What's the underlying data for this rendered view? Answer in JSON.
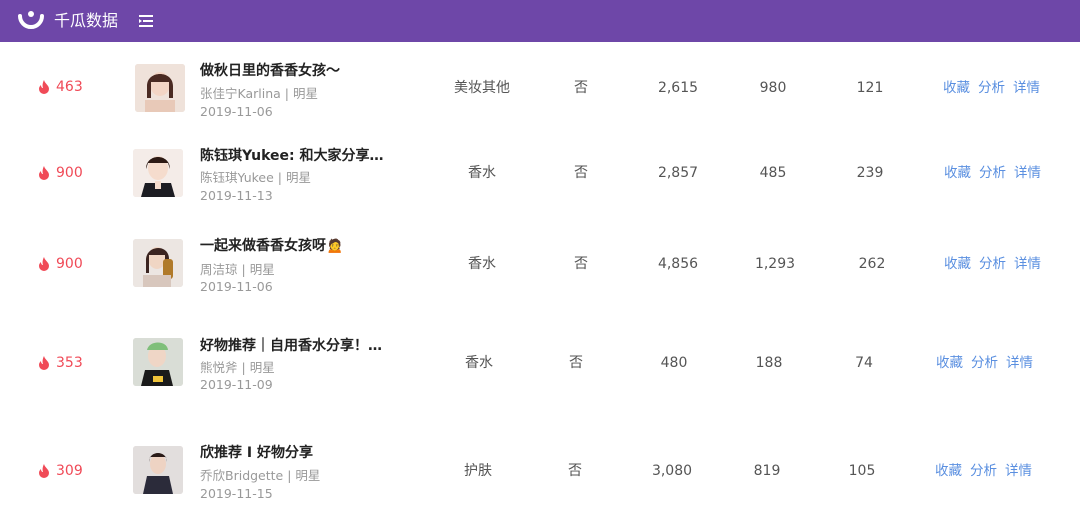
{
  "header": {
    "app_name": "千瓜数据",
    "brand_color": "#6e47a8",
    "logo_icon": "qiangua-logo-icon",
    "menu_icon": "menu-fold-icon"
  },
  "colors": {
    "heat": "#f04a57",
    "link": "#5a8fe0"
  },
  "rows": [
    {
      "heat": "463",
      "title": "做秋日里的香香女孩～",
      "author": "张佳宁Karlina",
      "role": "明星",
      "date": "2019-11-06",
      "category": "美妆其他",
      "commercial": "否",
      "likes": "2,615",
      "collects": "980",
      "comments": "121",
      "actions": [
        "收藏",
        "分析",
        "详情"
      ]
    },
    {
      "heat": "900",
      "title": "陈钰琪Yukee: 和大家分享…",
      "author": "陈钰琪Yukee",
      "role": "明星",
      "date": "2019-11-13",
      "category": "香水",
      "commercial": "否",
      "likes": "2,857",
      "collects": "485",
      "comments": "239",
      "actions": [
        "收藏",
        "分析",
        "详情"
      ]
    },
    {
      "heat": "900",
      "title": "一起来做香香女孩呀🙍",
      "author": "周洁琼",
      "role": "明星",
      "date": "2019-11-06",
      "category": "香水",
      "commercial": "否",
      "likes": "4,856",
      "collects": "1,293",
      "comments": "262",
      "actions": [
        "收藏",
        "分析",
        "详情"
      ]
    },
    {
      "heat": "353",
      "title": "好物推荐｜自用香水分享！…",
      "author": "熊悦斧",
      "role": "明星",
      "date": "2019-11-09",
      "category": "香水",
      "commercial": "否",
      "likes": "480",
      "collects": "188",
      "comments": "74",
      "actions": [
        "收藏",
        "分析",
        "详情"
      ]
    },
    {
      "heat": "309",
      "title": "欣推荐 I 好物分享",
      "author": "乔欣Bridgette",
      "role": "明星",
      "date": "2019-11-15",
      "category": "护肤",
      "commercial": "否",
      "likes": "3,080",
      "collects": "819",
      "comments": "105",
      "actions": [
        "收藏",
        "分析",
        "详情"
      ]
    }
  ]
}
